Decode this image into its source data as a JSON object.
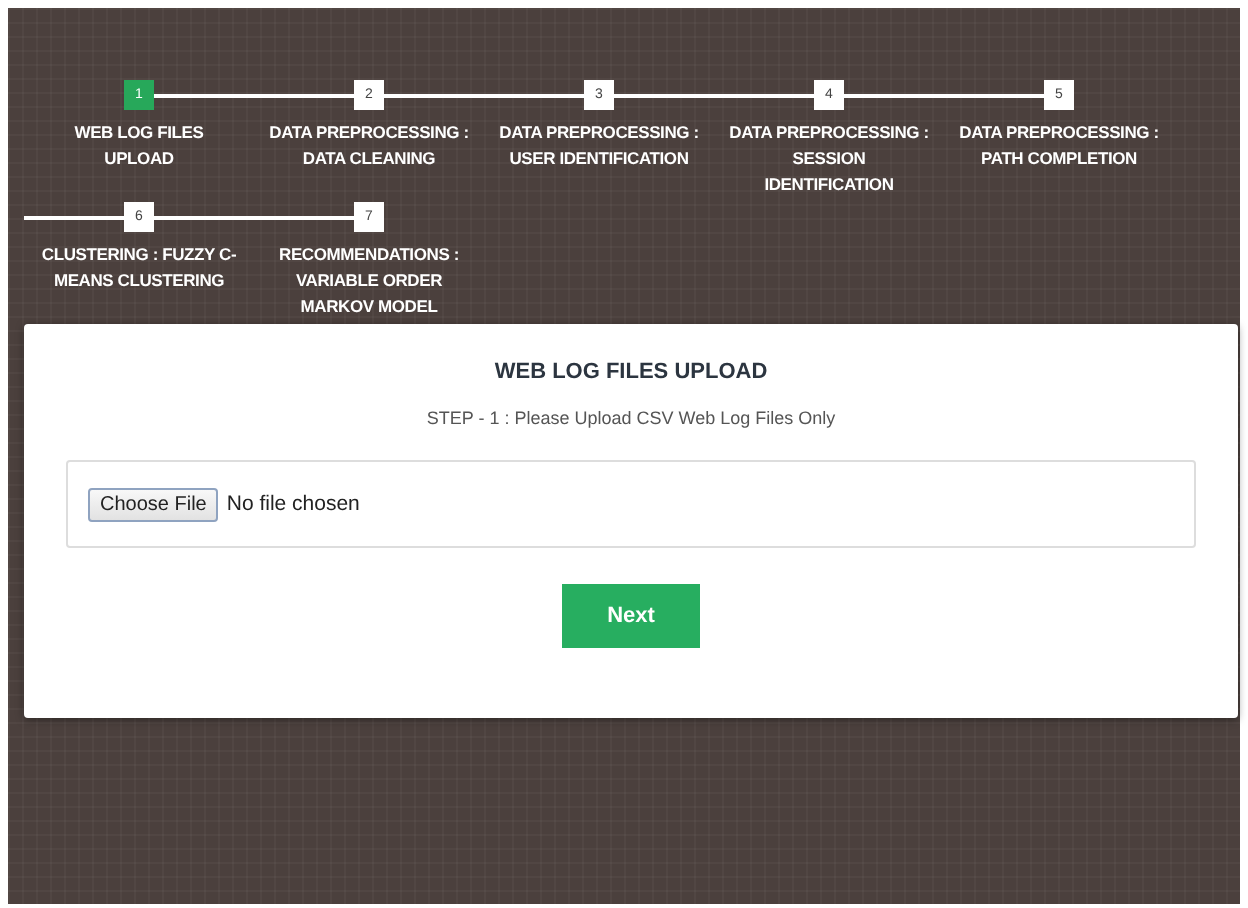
{
  "steps": [
    {
      "number": "1",
      "label": "WEB LOG FILES UPLOAD",
      "selected": true
    },
    {
      "number": "2",
      "label": "DATA PREPROCESSING : DATA CLEANING",
      "selected": false
    },
    {
      "number": "3",
      "label": "DATA PREPROCESSING : USER IDENTIFICATION",
      "selected": false
    },
    {
      "number": "4",
      "label": "DATA PREPROCESSING : SESSION IDENTIFICATION",
      "selected": false
    },
    {
      "number": "5",
      "label": "DATA PREPROCESSING : PATH COMPLETION",
      "selected": false
    },
    {
      "number": "6",
      "label": "CLUSTERING : FUZZY C-MEANS CLUSTERING",
      "selected": false
    },
    {
      "number": "7",
      "label": "RECOMMENDATIONS : VARIABLE ORDER MARKOV MODEL",
      "selected": false
    }
  ],
  "card": {
    "title": "WEB LOG FILES UPLOAD",
    "subtitle": "STEP - 1 : Please Upload CSV Web Log Files Only",
    "file_button": "Choose File",
    "file_status": "No file chosen",
    "next_button": "Next"
  }
}
